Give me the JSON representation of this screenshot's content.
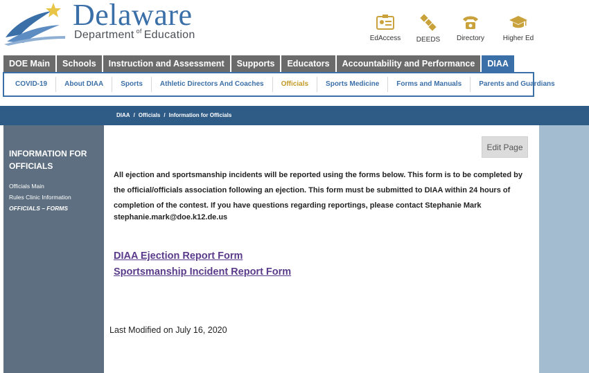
{
  "logo": {
    "word": "Delaware",
    "dept_prefix": "Department",
    "dept_of": "of",
    "dept_suffix": "Education"
  },
  "utility_links": [
    {
      "label": "EdAccess",
      "icon": "id-card-icon"
    },
    {
      "label": "DEEDS",
      "icon": "satellite-icon"
    },
    {
      "label": "Directory",
      "icon": "phone-icon"
    },
    {
      "label": "Higher Ed",
      "icon": "graduation-cap-icon"
    }
  ],
  "top_nav": [
    "DOE Main",
    "Schools",
    "Instruction and Assessment",
    "Supports",
    "Educators",
    "Accountability and Performance",
    "DIAA"
  ],
  "sub_nav": [
    "COVID-19",
    "About DIAA",
    "Sports",
    "Athletic Directors And Coaches",
    "Officials",
    "Sports Medicine",
    "Forms and Manuals",
    "Parents and Guardians"
  ],
  "breadcrumb": [
    "DIAA",
    "Officials",
    "Information for Officials"
  ],
  "sidebar": {
    "title": "Information for Officials",
    "links": [
      "Officials Main",
      "Rules Clinic Information",
      "Officials – Forms"
    ]
  },
  "main": {
    "edit_label": "Edit Page",
    "paragraph": "All ejection and sportsmanship incidents will be reported using the forms below.  This form is to be completed by the official/officials association following an ejection.  This form must be submitted to DIAA within 24 hours of completion of the contest.  If you have questions regarding reportings, please contact Stephanie Mark",
    "email": "stephanie.mark@doe.k12.de.us",
    "forms": [
      "DIAA Ejection Report Form",
      "Sportsmanship Incident Report Form"
    ],
    "last_modified": "Last Modified on July 16, 2020"
  },
  "colors": {
    "brand_blue": "#3b6fa8",
    "nav_gray": "#6b6b6b",
    "crumb_bar": "#2f5b87",
    "sidebar": "#5d6f80",
    "right_gutter": "#a3bccf",
    "active_sub": "#c29a24",
    "link_purple": "#5a3a8a"
  }
}
